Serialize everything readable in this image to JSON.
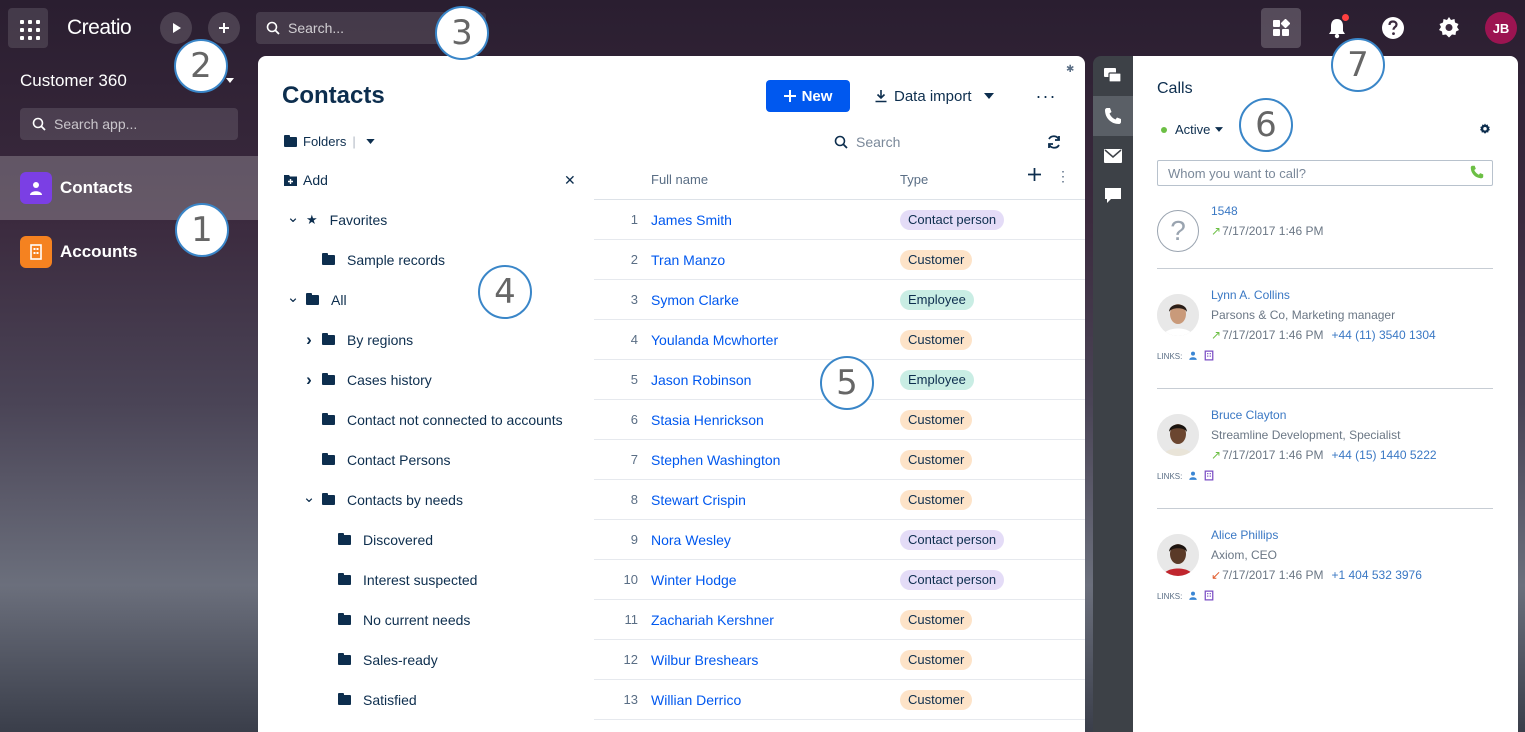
{
  "topbar": {
    "logo": "Creatio",
    "search_placeholder": "Search...",
    "user_initials": "JB"
  },
  "sidebar": {
    "workspace": "Customer 360",
    "search_placeholder": "Search app...",
    "items": [
      {
        "label": "Contacts",
        "icon": "user-icon",
        "color": "#7b3fe4",
        "selected": true
      },
      {
        "label": "Accounts",
        "icon": "building-icon",
        "color": "#f58220",
        "selected": false
      }
    ]
  },
  "main": {
    "title": "Contacts",
    "new_label": "New",
    "import_label": "Data import",
    "folders_label": "Folders",
    "search_placeholder": "Search",
    "add_label": "Add",
    "folders": [
      {
        "label": "Favorites",
        "level": 0,
        "arrow": "down",
        "icon": "star"
      },
      {
        "label": "Sample records",
        "level": 1,
        "arrow": "",
        "icon": "folder"
      },
      {
        "label": "All",
        "level": 0,
        "arrow": "down",
        "icon": "folder"
      },
      {
        "label": "By regions",
        "level": 1,
        "arrow": "right",
        "icon": "folder"
      },
      {
        "label": "Cases history",
        "level": 1,
        "arrow": "right",
        "icon": "folder"
      },
      {
        "label": "Contact not connected to accounts",
        "level": 1,
        "arrow": "",
        "icon": "folder"
      },
      {
        "label": "Contact Persons",
        "level": 1,
        "arrow": "",
        "icon": "folder"
      },
      {
        "label": "Contacts by needs",
        "level": 1,
        "arrow": "down",
        "icon": "folder"
      },
      {
        "label": "Discovered",
        "level": 2,
        "arrow": "",
        "icon": "folder"
      },
      {
        "label": "Interest suspected",
        "level": 2,
        "arrow": "",
        "icon": "folder"
      },
      {
        "label": "No current needs",
        "level": 2,
        "arrow": "",
        "icon": "folder"
      },
      {
        "label": "Sales-ready",
        "level": 2,
        "arrow": "",
        "icon": "folder"
      },
      {
        "label": "Satisfied",
        "level": 2,
        "arrow": "",
        "icon": "folder"
      }
    ],
    "columns": {
      "name": "Full name",
      "type": "Type"
    },
    "type_colors": {
      "Contact person": "#e4dcf7",
      "Customer": "#fde3c8",
      "Employee": "#c9ede4"
    },
    "rows": [
      {
        "num": "1",
        "name": "James Smith",
        "type": "Contact person"
      },
      {
        "num": "2",
        "name": "Tran Manzo",
        "type": "Customer"
      },
      {
        "num": "3",
        "name": "Symon Clarke",
        "type": "Employee"
      },
      {
        "num": "4",
        "name": "Youlanda Mcwhorter",
        "type": "Customer"
      },
      {
        "num": "5",
        "name": "Jason Robinson",
        "type": "Employee"
      },
      {
        "num": "6",
        "name": "Stasia Henrickson",
        "type": "Customer"
      },
      {
        "num": "7",
        "name": "Stephen Washington",
        "type": "Customer"
      },
      {
        "num": "8",
        "name": "Stewart Crispin",
        "type": "Customer"
      },
      {
        "num": "9",
        "name": "Nora Wesley",
        "type": "Contact person"
      },
      {
        "num": "10",
        "name": "Winter Hodge",
        "type": "Contact person"
      },
      {
        "num": "11",
        "name": "Zachariah Kershner",
        "type": "Customer"
      },
      {
        "num": "12",
        "name": "Wilbur Breshears",
        "type": "Customer"
      },
      {
        "num": "13",
        "name": "Willian Derrico",
        "type": "Customer"
      }
    ]
  },
  "calls": {
    "title": "Calls",
    "status": "Active",
    "input_placeholder": "Whom you want to call?",
    "links_label": "LINKS:",
    "items": [
      {
        "name": "1548",
        "org": "",
        "time": "7/17/2017 1:46 PM",
        "phone": "",
        "direction": "outgoing",
        "avatar": "unknown",
        "links": false
      },
      {
        "name": "Lynn A. Collins",
        "org": "Parsons & Co, Marketing manager",
        "time": "7/17/2017 1:46 PM",
        "phone": "+44 (11) 3540 1304",
        "direction": "outgoing",
        "avatar": "photo",
        "links": true
      },
      {
        "name": "Bruce Clayton",
        "org": "Streamline Development, Specialist",
        "time": "7/17/2017 1:46 PM",
        "phone": "+44 (15) 1440 5222",
        "direction": "outgoing",
        "avatar": "photo",
        "links": true
      },
      {
        "name": "Alice Phillips",
        "org": "Axiom, CEO",
        "time": "7/17/2017 1:46 PM",
        "phone": "+1 404 532 3976",
        "direction": "incoming",
        "avatar": "photo",
        "links": true
      }
    ]
  },
  "callouts": [
    "1",
    "2",
    "3",
    "4",
    "5",
    "6",
    "7"
  ]
}
